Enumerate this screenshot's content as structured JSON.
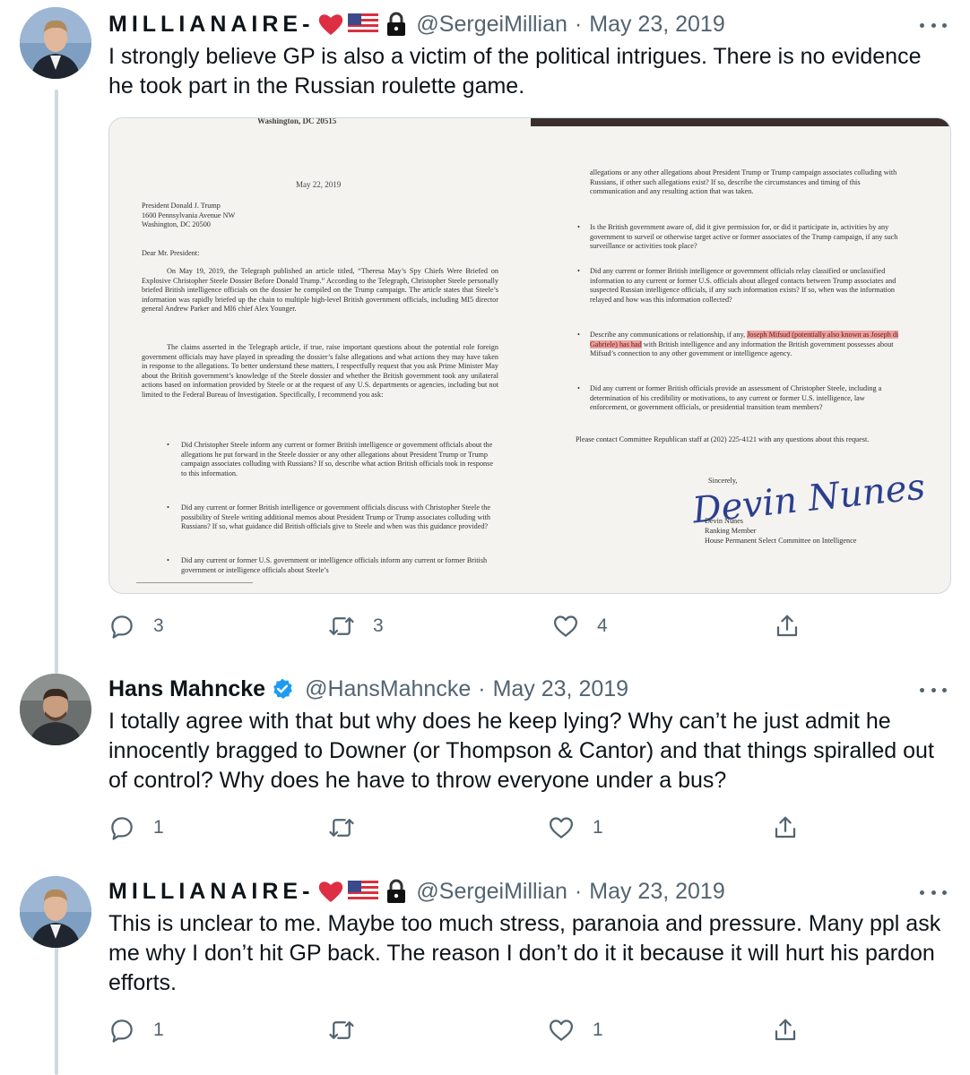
{
  "tweets": [
    {
      "display_name": "MILLIANAIRE-",
      "handle": "@SergeiMillian",
      "date": "May 23, 2019",
      "separator": "·",
      "text": "I strongly believe GP is also a victim of the political intrigues. There is no evidence he took part in the Russian roulette game.",
      "replies": "3",
      "retweets": "3",
      "likes": "4",
      "icons": [
        "heart-emoji",
        "us-flag-emoji",
        "lock-emoji"
      ]
    },
    {
      "display_name": "Hans Mahncke",
      "handle": "@HansMahncke",
      "date": "May 23, 2019",
      "separator": "·",
      "text": "I totally agree with that but why does he keep lying? Why can’t he just admit he innocently bragged to Downer (or Thompson & Cantor) and that things spiralled out of control? Why does he have to throw everyone under a bus?",
      "replies": "1",
      "retweets": "",
      "likes": "1",
      "icons": [
        "verified-badge-icon"
      ]
    },
    {
      "display_name": "MILLIANAIRE-",
      "handle": "@SergeiMillian",
      "date": "May 23, 2019",
      "separator": "·",
      "text": "This is unclear to me. Maybe too much stress, paranoia and pressure. Many ppl ask me why I don’t hit GP back. The reason I don’t do it it because it will hurt his pardon efforts.",
      "replies": "1",
      "retweets": "",
      "likes": "1",
      "icons": [
        "heart-emoji",
        "us-flag-emoji",
        "lock-emoji"
      ]
    }
  ],
  "document": {
    "top_header": "Washington, DC 20515",
    "date": "May 22, 2019",
    "addressee": [
      "President Donald J. Trump",
      "1600 Pennsylvania Avenue NW",
      "Washington, DC 20500"
    ],
    "salutation": "Dear Mr. President:",
    "para1": "On May 19, 2019, the Telegraph published an article titled, “Theresa May’s Spy Chiefs Were Briefed on Explosive Christopher Steele Dossier Before Donald Trump.” According to the Telegraph, Christopher Steele personally briefed British intelligence officials on the dossier he compiled on the Trump campaign. The article states that Steele’s information was rapidly briefed up the chain to multiple high-level British government officials, including MI5 director general Andrew Parker and MI6 chief Alex Younger.",
    "para2": "The claims asserted in the Telegraph article, if true, raise important questions about the potential role foreign government officials may have played in spreading the dossier’s false allegations and what actions they may have taken in response to the allegations. To better understand these matters, I respectfully request that you ask Prime Minister May about the British government’s knowledge of the Steele dossier and whether the British government took any unilateral actions based on information provided by Steele or at the request of any U.S. departments or agencies, including but not limited to the Federal Bureau of Investigation. Specifically, I recommend you ask:",
    "left_bullets": [
      "Did Christopher Steele inform any current or former British intelligence or government officials about the allegations he put forward in the Steele dossier or any other allegations about President Trump or Trump campaign associates colluding with Russians? If so, describe what action British officials took in response to this information.",
      "Did any current or former British intelligence or government officials discuss with Christopher Steele the possibility of Steele writing additional memos about President Trump or Trump associates colluding with Russians? If so, what guidance did British officials give to Steele and when was this guidance provided?",
      "Did any current or former U.S. government or intelligence officials inform any current or former British government or intelligence officials about Steele’s"
    ],
    "right_top": "allegations or any other allegations about President Trump or Trump campaign associates colluding with Russians, if other such allegations exist? If so, describe the circumstances and timing of this communication and any resulting action that was taken.",
    "right_bullets": [
      "Is the British government aware of, did it give permission for, or did it participate in, activities by any government to surveil or otherwise target active or former associates of the Trump campaign, if any such surveillance or activities took place?",
      "Did any current or former British intelligence or government officials relay classified or unclassified information to any current or former U.S. officials about alleged contacts between Trump associates and suspected Russian intelligence officials, if any such information exists? If so, when was the information relayed and how was this information collected?",
      "Did any current or former British officials provide an assessment of Christopher Steele, including a determination of his credibility or motivations, to any current or former U.S. intelligence, law enforcement, or government officials, or presidential transition team members?"
    ],
    "mifsud_pre": "Describe any communications or relationship, if any,",
    "mifsud_hl1": "Joseph Mifsud (potentially also known as Joseph di Gabriele) has had",
    "mifsud_post": "with British intelligence and any information the British government possesses about Mifsud’s connection to any other government or intelligence agency.",
    "contact": "Please contact Committee Republican staff at (202) 225-4121 with any questions about this request.",
    "closing": "Sincerely,",
    "signature": "Devin Nunes",
    "sign_name": "Devin Nunes",
    "sign_title": "Ranking Member",
    "sign_committee": "House Permanent Select Committee on Intelligence"
  }
}
